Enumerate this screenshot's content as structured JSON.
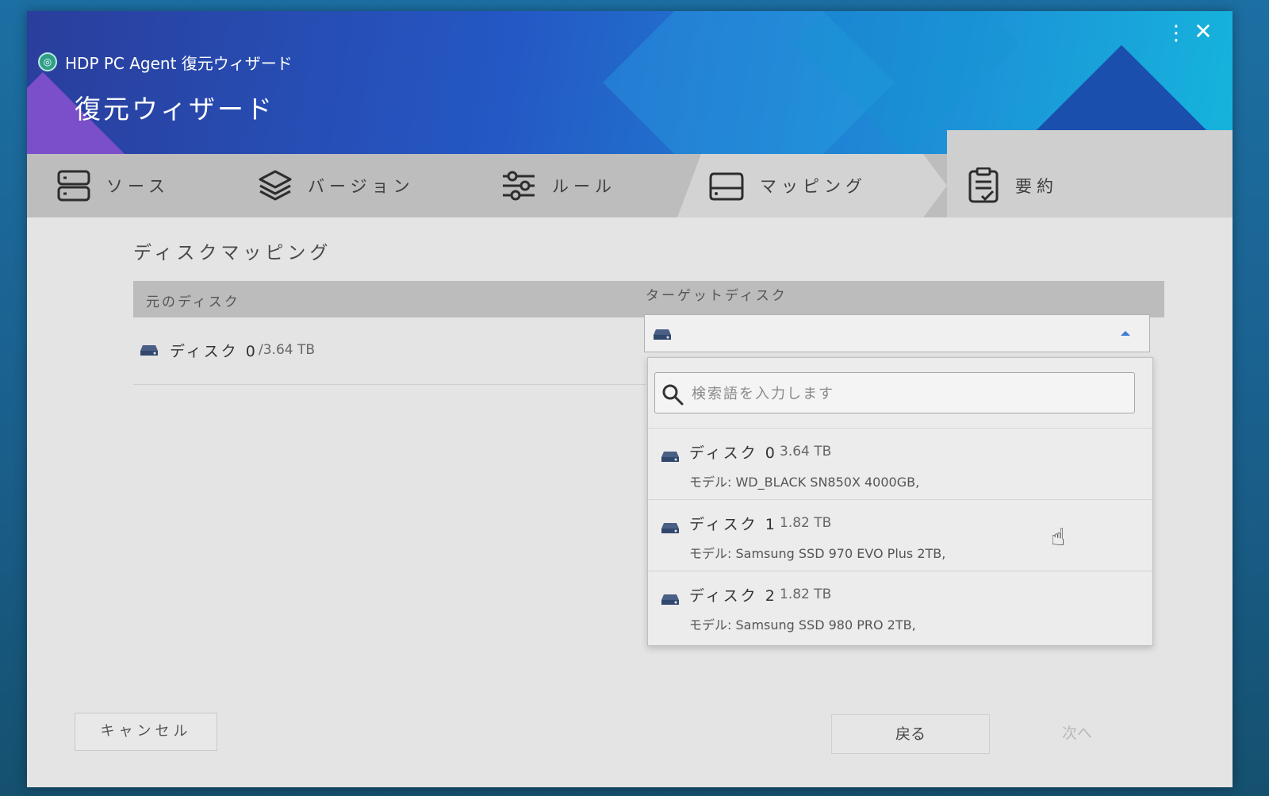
{
  "window": {
    "app_title": "HDP PC Agent 復元ウィザード",
    "heading": "復元ウィザード"
  },
  "steps": [
    {
      "label": "ソース",
      "icon": "server-icon"
    },
    {
      "label": "バージョン",
      "icon": "layers-icon"
    },
    {
      "label": "ルール",
      "icon": "sliders-icon"
    },
    {
      "label": "マッピング",
      "icon": "drive-icon"
    },
    {
      "label": "要約",
      "icon": "clipboard-check-icon"
    }
  ],
  "mapping": {
    "section_title": "ディスクマッピング",
    "columns": {
      "source": "元のディスク",
      "target": "ターゲットディスク"
    },
    "source_disk": {
      "name": "ディスク 0",
      "size": "/3.64 TB"
    },
    "search_placeholder": "検索語を入力します",
    "options": [
      {
        "name": "ディスク 0",
        "size": "3.64 TB",
        "model": "モデル: WD_BLACK SN850X 4000GB,"
      },
      {
        "name": "ディスク 1",
        "size": "1.82 TB",
        "model": "モデル: Samsung SSD 970 EVO Plus 2TB,"
      },
      {
        "name": "ディスク 2",
        "size": "1.82 TB",
        "model": "モデル: Samsung SSD 980 PRO 2TB,"
      }
    ]
  },
  "footer": {
    "cancel_label": "キャンセル",
    "back_label": "戻る",
    "next_label": "次へ"
  },
  "colors": {
    "accent": "#3a7bd5",
    "header_start": "#2a3e9c",
    "header_end": "#15b4dc",
    "disk_icon": "#4a5f86"
  }
}
